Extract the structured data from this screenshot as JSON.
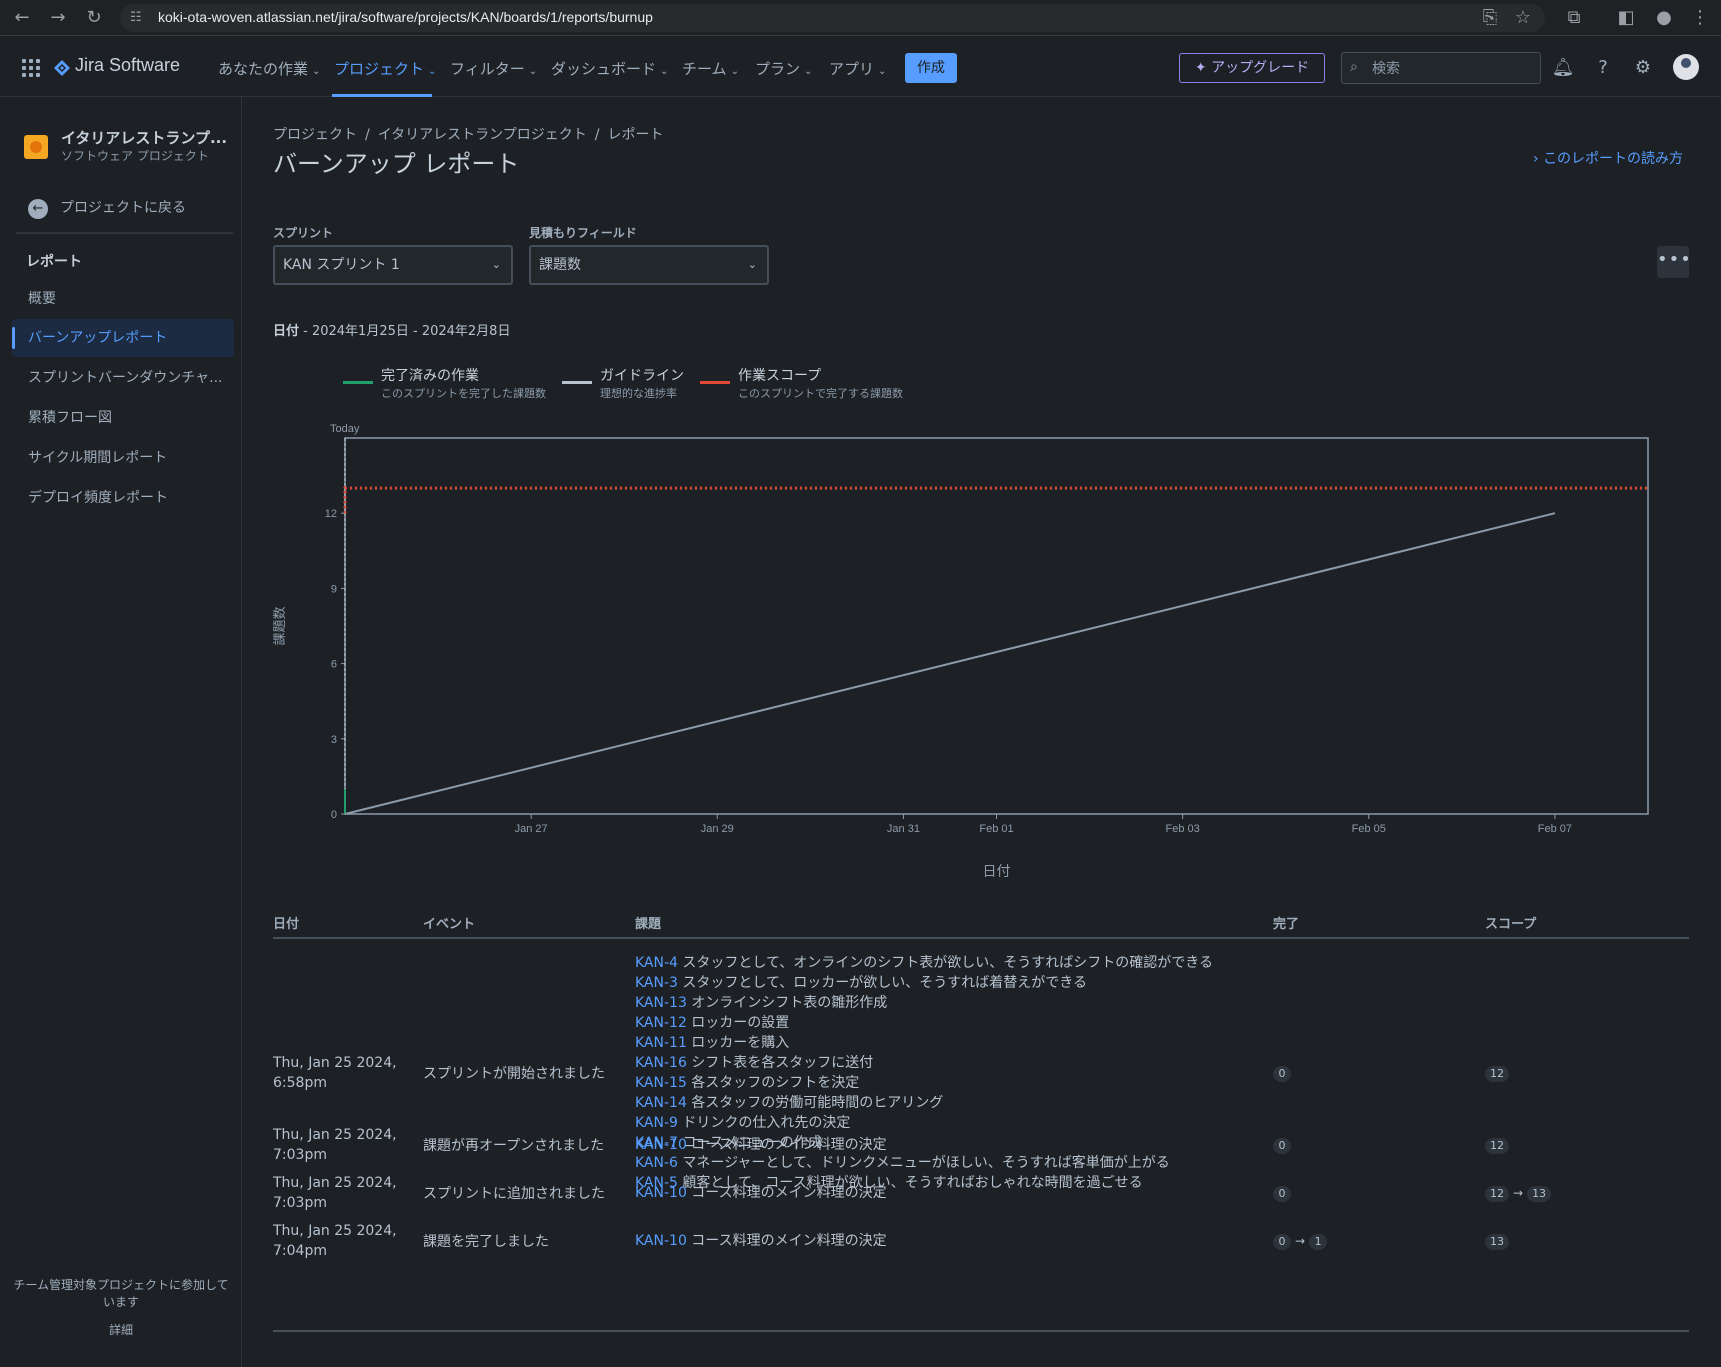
{
  "browser": {
    "url": "koki-ota-woven.atlassian.net/jira/software/projects/KAN/boards/1/reports/burnup"
  },
  "topnav": {
    "product": "Jira Software",
    "items": [
      {
        "label": "あなたの作業"
      },
      {
        "label": "プロジェクト"
      },
      {
        "label": "フィルター"
      },
      {
        "label": "ダッシュボード"
      },
      {
        "label": "チーム"
      },
      {
        "label": "プラン"
      },
      {
        "label": "アプリ"
      }
    ],
    "create": "作成",
    "upgrade": "アップグレード",
    "search_placeholder": "検索"
  },
  "sidebar": {
    "project_name": "イタリアレストランプ...",
    "project_type": "ソフトウェア プロジェクト",
    "back": "プロジェクトに戻る",
    "heading": "レポート",
    "items": [
      {
        "label": "概要"
      },
      {
        "label": "バーンアップレポート"
      },
      {
        "label": "スプリントバーンダウンチャ..."
      },
      {
        "label": "累積フロー図"
      },
      {
        "label": "サイクル期間レポート"
      },
      {
        "label": "デプロイ頻度レポート"
      }
    ],
    "footer": "チーム管理対象プロジェクトに参加しています",
    "detail": "詳細"
  },
  "main": {
    "breadcrumb": [
      "プロジェクト",
      "イタリアレストランプロジェクト",
      "レポート"
    ],
    "title": "バーンアップ レポート",
    "help_link": "このレポートの読み方",
    "sprint_label": "スプリント",
    "sprint_value": "KAN スプリント 1",
    "estimate_label": "見積もりフィールド",
    "estimate_value": "課題数",
    "date_label": "日付",
    "date_range": " - 2024年1月25日 - 2024年2月8日"
  },
  "legend": [
    {
      "title": "完了済みの作業",
      "sub": "このスプリントを完了した課題数",
      "color": "#22a06b"
    },
    {
      "title": "ガイドライン",
      "sub": "理想的な進捗率",
      "color": "#b6c2cf"
    },
    {
      "title": "作業スコープ",
      "sub": "このスプリントで完了する課題数",
      "color": "#e34935"
    }
  ],
  "chart_data": {
    "type": "line",
    "title": "",
    "xlabel": "日付",
    "ylabel": "課題数",
    "today_label": "Today",
    "x_ticks": [
      "Jan 27",
      "Jan 29",
      "Jan 31",
      "Feb 01",
      "Feb 03",
      "Feb 05",
      "Feb 07"
    ],
    "x_tick_days": [
      2,
      4,
      6,
      7,
      9,
      11,
      13
    ],
    "x_range_days": [
      0,
      14
    ],
    "y_ticks": [
      0,
      3,
      6,
      9,
      12
    ],
    "ylim": [
      0,
      15
    ],
    "series": [
      {
        "name": "完了済みの作業",
        "color": "#22a06b",
        "points": [
          [
            0,
            0
          ],
          [
            0,
            1
          ]
        ]
      },
      {
        "name": "ガイドライン",
        "color": "#8c9bab",
        "points": [
          [
            0,
            0
          ],
          [
            13,
            12
          ]
        ]
      },
      {
        "name": "作業スコープ",
        "color": "#e34935",
        "points": [
          [
            0,
            12
          ],
          [
            0,
            13
          ],
          [
            14,
            13
          ]
        ]
      }
    ]
  },
  "table": {
    "headers": {
      "date": "日付",
      "event": "イベント",
      "issue": "課題",
      "done": "完了",
      "scope": "スコープ"
    },
    "rows": [
      {
        "date": "Thu, Jan 25 2024, 6:58pm",
        "event": "スプリントが開始されました",
        "issues": [
          {
            "key": "KAN-4",
            "summary": "スタッフとして、オンラインのシフト表が欲しい、そうすればシフトの確認ができる"
          },
          {
            "key": "KAN-3",
            "summary": "スタッフとして、ロッカーが欲しい、そうすれば着替えができる"
          },
          {
            "key": "KAN-13",
            "summary": "オンラインシフト表の雛形作成"
          },
          {
            "key": "KAN-12",
            "summary": "ロッカーの設置"
          },
          {
            "key": "KAN-11",
            "summary": "ロッカーを購入"
          },
          {
            "key": "KAN-16",
            "summary": "シフト表を各スタッフに送付"
          },
          {
            "key": "KAN-15",
            "summary": "各スタッフのシフトを決定"
          },
          {
            "key": "KAN-14",
            "summary": "各スタッフの労働可能時間のヒアリング"
          },
          {
            "key": "KAN-9",
            "summary": "ドリンクの仕入れ先の決定"
          },
          {
            "key": "KAN-7",
            "summary": "コースメニューの作成"
          },
          {
            "key": "KAN-6",
            "summary": "マネージャーとして、ドリンクメニューがほしい、そうすれば客単価が上がる"
          },
          {
            "key": "KAN-5",
            "summary": "顧客として、コース料理が欲しい、そうすればおしゃれな時間を過ごせる"
          }
        ],
        "done": "0",
        "done_to": null,
        "scope": "12",
        "scope_to": null
      },
      {
        "date": "Thu, Jan 25 2024, 7:03pm",
        "event": "課題が再オープンされました",
        "issues": [
          {
            "key": "KAN-10",
            "summary": "コース料理のメイン料理の決定"
          }
        ],
        "done": "0",
        "done_to": null,
        "scope": "12",
        "scope_to": null
      },
      {
        "date": "Thu, Jan 25 2024, 7:03pm",
        "event": "スプリントに追加されました",
        "issues": [
          {
            "key": "KAN-10",
            "summary": "コース料理のメイン料理の決定"
          }
        ],
        "done": "0",
        "done_to": null,
        "scope": "12",
        "scope_to": "13"
      },
      {
        "date": "Thu, Jan 25 2024, 7:04pm",
        "event": "課題を完了しました",
        "issues": [
          {
            "key": "KAN-10",
            "summary": "コース料理のメイン料理の決定"
          }
        ],
        "done": "0",
        "done_to": "1",
        "scope": "13",
        "scope_to": null
      }
    ]
  }
}
